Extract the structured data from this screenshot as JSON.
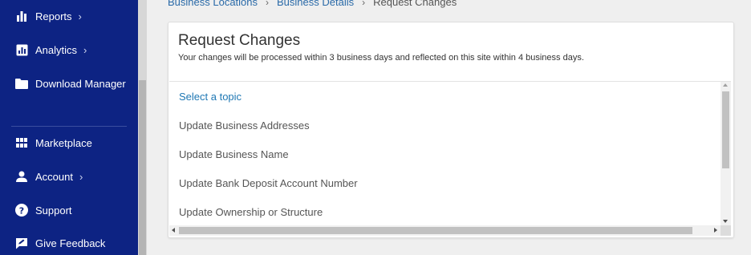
{
  "sidebar": {
    "items": [
      {
        "label": "Reports",
        "icon": "bar-chart-icon",
        "has_chevron": true
      },
      {
        "label": "Analytics",
        "icon": "analytics-icon",
        "has_chevron": true
      },
      {
        "label": "Download Manager",
        "icon": "folder-icon",
        "has_chevron": false
      },
      {
        "label": "Marketplace",
        "icon": "grid-icon",
        "has_chevron": false
      },
      {
        "label": "Account",
        "icon": "person-icon",
        "has_chevron": true
      },
      {
        "label": "Support",
        "icon": "help-icon",
        "has_chevron": false
      },
      {
        "label": "Give Feedback",
        "icon": "feedback-icon",
        "has_chevron": false
      }
    ],
    "chevron": "›",
    "background": "#0d2383"
  },
  "breadcrumb": {
    "items": [
      "Business Locations",
      "Business Details",
      "Request Changes"
    ],
    "separator": "›"
  },
  "card": {
    "title": "Request Changes",
    "subtitle": "Your changes will be processed within 3 business days and reflected on this site within 4 business days."
  },
  "topic_list": {
    "placeholder": "Select a topic",
    "options": [
      "Update Business Addresses",
      "Update Business Name",
      "Update Bank Deposit Account Number",
      "Update Ownership or Structure"
    ]
  },
  "colors": {
    "link": "#1f78b4",
    "sidebar": "#0d2383",
    "page_background": "#efefef"
  }
}
